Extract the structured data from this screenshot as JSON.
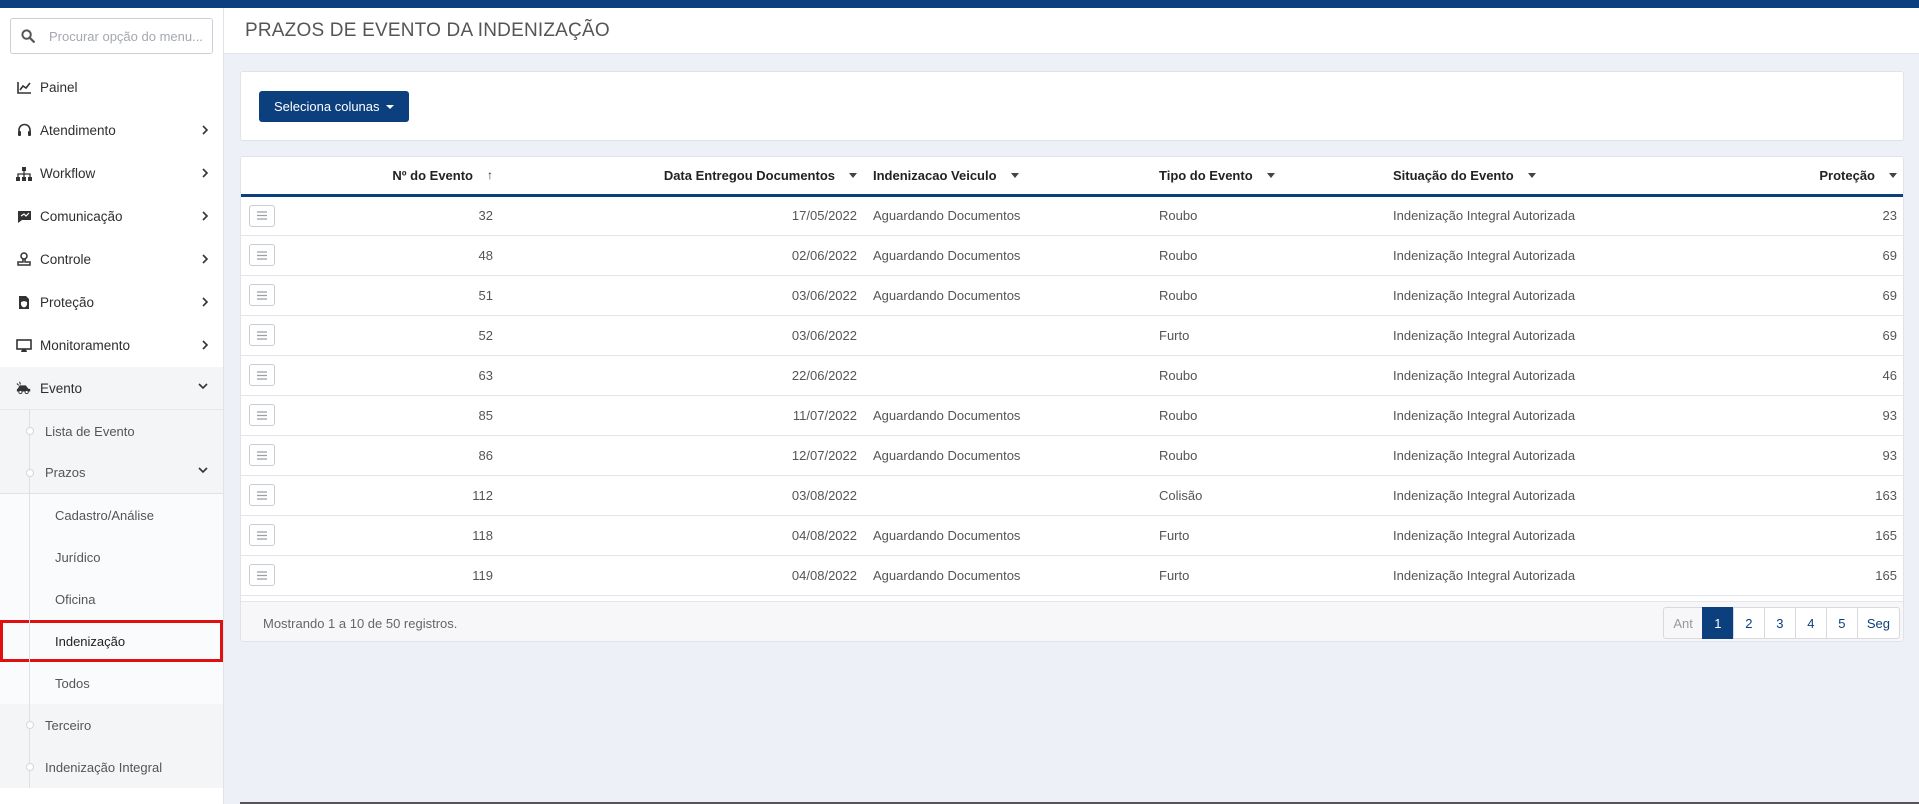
{
  "search": {
    "placeholder": "Procurar opção do menu..."
  },
  "sidebar": {
    "items": [
      {
        "label": "Painel",
        "icon": "chart-line-icon"
      },
      {
        "label": "Atendimento",
        "icon": "headset-icon"
      },
      {
        "label": "Workflow",
        "icon": "sitemap-icon"
      },
      {
        "label": "Comunicação",
        "icon": "comment-icon"
      },
      {
        "label": "Controle",
        "icon": "stamp-icon"
      },
      {
        "label": "Proteção",
        "icon": "file-shield-icon"
      },
      {
        "label": "Monitoramento",
        "icon": "desktop-icon"
      },
      {
        "label": "Evento",
        "icon": "car-crash-icon"
      }
    ],
    "evento_sub": {
      "lista": "Lista de Evento",
      "prazos": "Prazos",
      "prazos_sub": [
        "Cadastro/Análise",
        "Jurídico",
        "Oficina",
        "Indenização",
        "Todos"
      ],
      "terceiro": "Terceiro",
      "indenizacao_integral": "Indenização Integral"
    }
  },
  "page": {
    "title": "PRAZOS DE EVENTO DA INDENIZAÇÃO"
  },
  "toolbar": {
    "select_columns": "Seleciona colunas"
  },
  "table": {
    "headers": [
      "Nº do Evento",
      "Data Entregou Documentos",
      "Indenizacao Veiculo",
      "Tipo do Evento",
      "Situação do Evento",
      "Proteção"
    ],
    "rows": [
      [
        "32",
        "17/05/2022",
        "Aguardando Documentos",
        "Roubo",
        "Indenização Integral Autorizada",
        "23"
      ],
      [
        "48",
        "02/06/2022",
        "Aguardando Documentos",
        "Roubo",
        "Indenização Integral Autorizada",
        "69"
      ],
      [
        "51",
        "03/06/2022",
        "Aguardando Documentos",
        "Roubo",
        "Indenização Integral Autorizada",
        "69"
      ],
      [
        "52",
        "03/06/2022",
        "",
        "Furto",
        "Indenização Integral Autorizada",
        "69"
      ],
      [
        "63",
        "22/06/2022",
        "",
        "Roubo",
        "Indenização Integral Autorizada",
        "46"
      ],
      [
        "85",
        "11/07/2022",
        "Aguardando Documentos",
        "Roubo",
        "Indenização Integral Autorizada",
        "93"
      ],
      [
        "86",
        "12/07/2022",
        "Aguardando Documentos",
        "Roubo",
        "Indenização Integral Autorizada",
        "93"
      ],
      [
        "112",
        "03/08/2022",
        "",
        "Colisão",
        "Indenização Integral Autorizada",
        "163"
      ],
      [
        "118",
        "04/08/2022",
        "Aguardando Documentos",
        "Furto",
        "Indenização Integral Autorizada",
        "165"
      ],
      [
        "119",
        "04/08/2022",
        "Aguardando Documentos",
        "Furto",
        "Indenização Integral Autorizada",
        "165"
      ]
    ],
    "footer_info": "Mostrando 1 a 10 de 50 registros."
  },
  "pagination": {
    "prev": "Ant",
    "pages": [
      "1",
      "2",
      "3",
      "4",
      "5"
    ],
    "active": "1",
    "next": "Seg"
  },
  "colors": {
    "brand": "#0c3f7d",
    "highlight": "#e01010"
  }
}
